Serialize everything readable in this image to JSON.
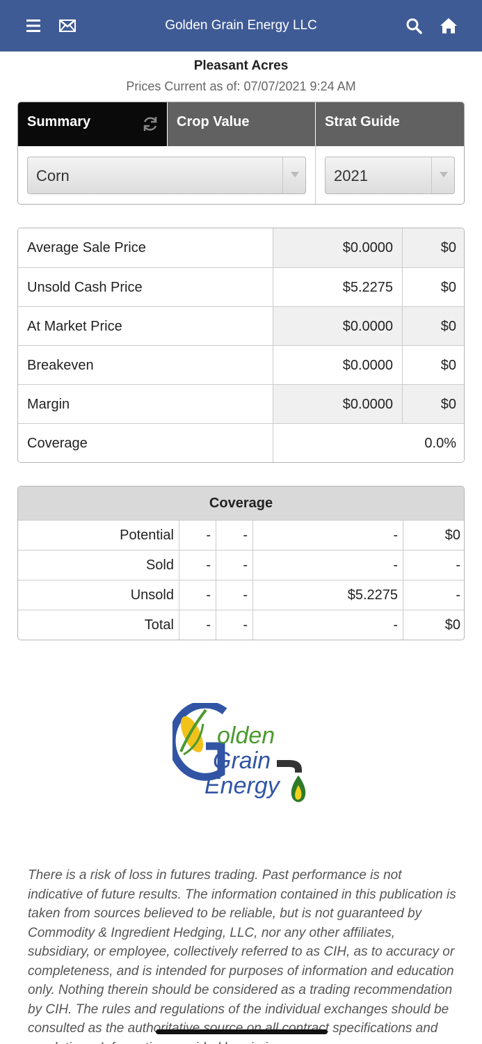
{
  "header": {
    "title": "Golden Grain Energy LLC",
    "icons": [
      "menu-icon",
      "mail-icon",
      "search-icon",
      "home-icon"
    ],
    "color": "#3f5b96"
  },
  "location": {
    "name": "Pleasant Acres",
    "prices_current": "Prices Current as of: 07/07/2021 9:24 AM"
  },
  "tabs": {
    "summary": "Summary",
    "crop_value": "Crop Value",
    "strat_guide": "Strat Guide",
    "active": "Summary"
  },
  "filters": {
    "crop": "Corn",
    "year": "2021"
  },
  "summary": {
    "rows": [
      {
        "label": "Average Sale Price",
        "price": "$0.0000",
        "total": "$0"
      },
      {
        "label": "Unsold Cash Price",
        "price": "$5.2275",
        "total": "$0"
      },
      {
        "label": "At Market Price",
        "price": "$0.0000",
        "total": "$0"
      },
      {
        "label": "Breakeven",
        "price": "$0.0000",
        "total": "$0"
      },
      {
        "label": "Margin",
        "price": "$0.0000",
        "total": "$0"
      }
    ],
    "coverage": {
      "label": "Coverage",
      "value": "0.0%"
    }
  },
  "coverage_table": {
    "title": "Coverage",
    "rows": [
      {
        "label": "Potential",
        "c2": "-",
        "c3": "-",
        "c4": "-",
        "c5": "$0"
      },
      {
        "label": "Sold",
        "c2": "-",
        "c3": "-",
        "c4": "-",
        "c5": "-"
      },
      {
        "label": "Unsold",
        "c2": "-",
        "c3": "-",
        "c4": "$5.2275",
        "c5": "-"
      },
      {
        "label": "Total",
        "c2": "-",
        "c3": "-",
        "c4": "-",
        "c5": "$0"
      }
    ]
  },
  "logo": {
    "line1": "olden",
    "line2": "Grain",
    "line3": "Energy"
  },
  "disclaimer": "There is a risk of loss in futures trading. Past performance is not indicative of future results. The information contained in this publication is taken from sources believed to be reliable, but is not guaranteed by Commodity & Ingredient Hedging, LLC, nor any other affiliates, subsidiary, or employee, collectively referred to as CIH, as to accuracy or completeness, and is intended for purposes of information and education only. Nothing therein should be considered as a trading recommendation by CIH. The rules and regulations of the individual exchanges should be consulted as the authoritative source on all contract specifications and regulations. Information provided herein is"
}
